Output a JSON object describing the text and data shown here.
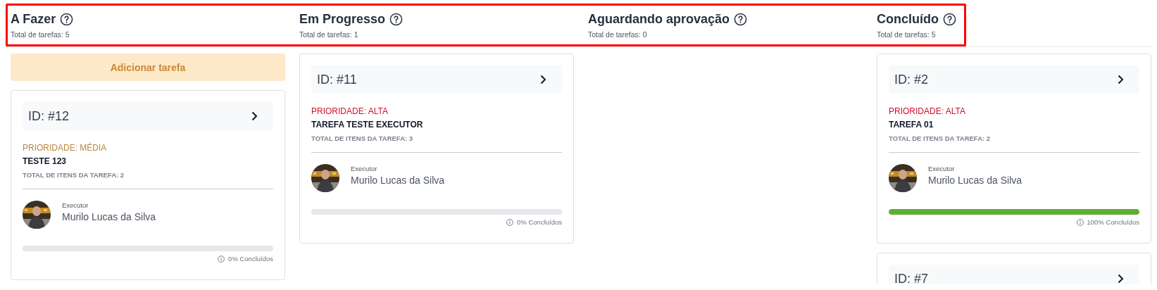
{
  "columns": [
    {
      "title": "A Fazer",
      "count_label": "Total de tarefas: 5",
      "add_button": {
        "label": "Adicionar tarefa",
        "disabled": true
      },
      "cards": [
        {
          "id_label": "ID: #12",
          "priority": "PRIORIDADE: MÉDIA",
          "color": "#b8873f",
          "name": "TESTE 123",
          "items_label": "TOTAL DE ITENS DA TAREFA: 2",
          "role": "Executor",
          "person": "Murilo Lucas da Silva",
          "level": 0,
          "progress_label": "0% Concluídos"
        }
      ]
    },
    {
      "title": "Em Progresso",
      "count_label": "Total de tarefas: 1",
      "cards": [
        {
          "id_label": "ID: #11",
          "priority": "PRIORIDADE: ALTA",
          "color": "#d0112b",
          "name": "TAREFA TESTE EXECUTOR",
          "items_label": "TOTAL DE ITENS DA TAREFA: 3",
          "role": "Executor",
          "person": "Murilo Lucas da Silva",
          "level": 0,
          "progress_label": "0% Concluídos"
        }
      ]
    },
    {
      "title": "Aguardando aprovação",
      "count_label": "Total de tarefas: 0"
    },
    {
      "title": "Concluído",
      "count_label": "Total de tarefas: 5",
      "cards": [
        {
          "id_label": "ID: #2",
          "priority": "PRIORIDADE: ALTA",
          "color": "#d0112b",
          "name": "TAREFA 01",
          "items_label": "TOTAL DE ITENS DA TAREFA: 2",
          "role": "Executor",
          "person": "Murilo Lucas da Silva",
          "level": 1,
          "progress_label": "100% Concluídos"
        },
        {
          "id_label": "ID: #7"
        }
      ]
    }
  ]
}
